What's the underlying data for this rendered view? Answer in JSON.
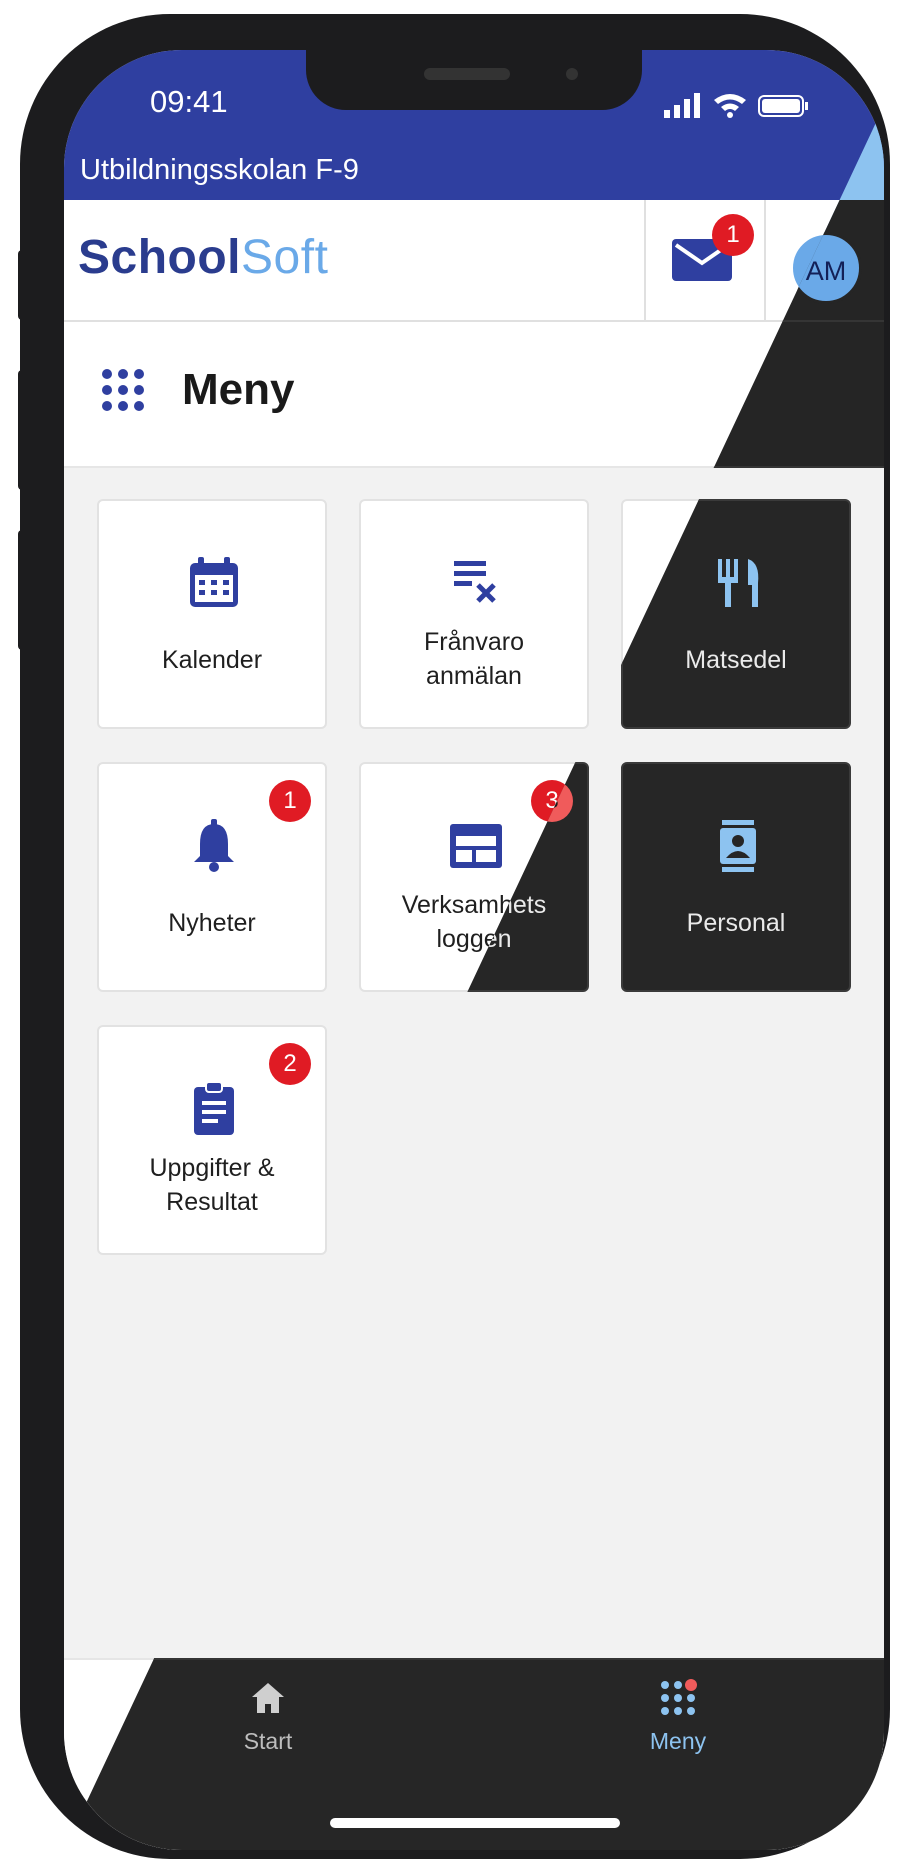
{
  "status": {
    "time": "09:41"
  },
  "school_name": "Utbildningsskolan F-9",
  "logo": {
    "part1": "School",
    "part2": "Soft"
  },
  "messages": {
    "badge": "1",
    "icon": "mail-icon"
  },
  "avatar": {
    "initials": "AM"
  },
  "menu": {
    "title": "Meny",
    "icon": "grid-icon"
  },
  "tiles": [
    {
      "label": "Kalender",
      "icon": "calendar-icon",
      "badge": ""
    },
    {
      "label_line1": "Frånvaro",
      "label_line2": "anmälan",
      "icon": "absence-icon",
      "badge": ""
    },
    {
      "label": "Matsedel",
      "icon": "cutlery-icon",
      "badge": ""
    },
    {
      "label": "Nyheter",
      "icon": "bell-icon",
      "badge": "1"
    },
    {
      "label_line1": "Verksamhets",
      "label_line2": "loggen",
      "icon": "log-icon",
      "badge": "3"
    },
    {
      "label": "Personal",
      "icon": "staff-icon",
      "badge": ""
    },
    {
      "label_line1": "Uppgifter &",
      "label_line2": "Resultat",
      "icon": "clipboard-icon",
      "badge": "2"
    }
  ],
  "bottom_nav": [
    {
      "label": "Start",
      "icon": "home-icon",
      "active": false
    },
    {
      "label": "Meny",
      "icon": "grid-icon",
      "active": true
    }
  ],
  "colors": {
    "brand_blue": "#2f3fa0",
    "accent_light_blue": "#6aa9e8",
    "badge_red": "#e01b24",
    "dark_bg": "#161616",
    "dark_tile": "#262626"
  }
}
